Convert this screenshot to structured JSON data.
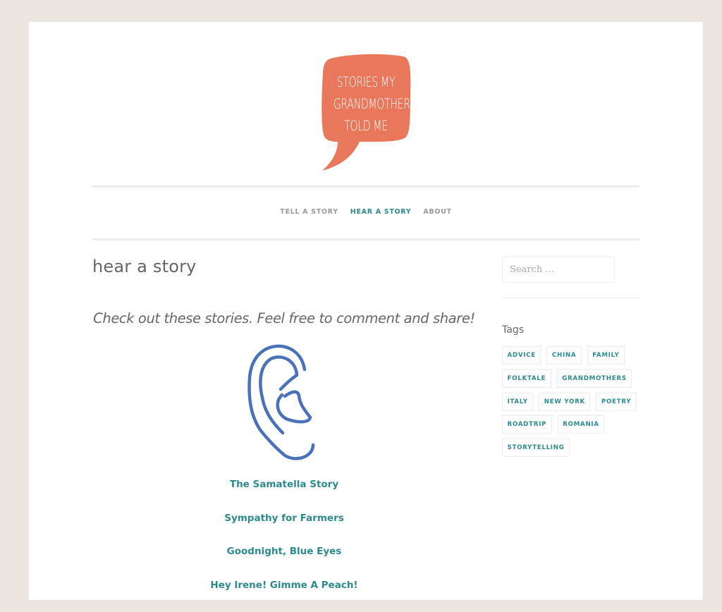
{
  "site": {
    "logo_lines": [
      "STORIES MY",
      "GRANDMOTHER",
      "TOLD ME"
    ],
    "logo_color": "#e8775b",
    "accent_color": "#2c8a8e",
    "background_color": "#ece5df"
  },
  "nav": {
    "items": [
      {
        "label": "Tell a Story",
        "active": false
      },
      {
        "label": "Hear a Story",
        "active": true
      },
      {
        "label": "About",
        "active": false
      }
    ]
  },
  "main": {
    "title": "hear a story",
    "intro": "Check out these stories. Feel free to comment and share!",
    "image_icon": "ear-icon",
    "ear_color": "#4a72b8",
    "stories": [
      {
        "label": "The Samatella Story"
      },
      {
        "label": "Sympathy for Farmers"
      },
      {
        "label": "Goodnight, Blue Eyes"
      },
      {
        "label": "Hey Irene! Gimme A Peach!"
      }
    ]
  },
  "sidebar": {
    "search_placeholder": "Search …",
    "search_value": "",
    "tags_title": "Tags",
    "tag_rows": [
      [
        "advice",
        "china",
        "family"
      ],
      [
        "folktale",
        "grandmothers"
      ],
      [
        "italy",
        "new york",
        "poetry"
      ],
      [
        "roadtrip",
        "romania"
      ],
      [
        "storytelling"
      ]
    ]
  }
}
